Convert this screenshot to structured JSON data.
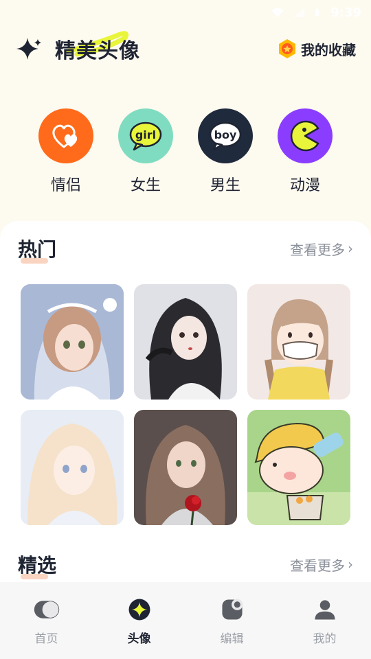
{
  "status_bar": {
    "time": "9:39"
  },
  "header": {
    "title": "精美头像",
    "favorites_label": "我的收藏"
  },
  "categories": [
    {
      "label": "情侣",
      "color": "#ff6b1a",
      "icon": "heart-icon"
    },
    {
      "label": "女生",
      "color": "#7fdcc0",
      "icon": "girl-bubble-icon",
      "badge": "girl"
    },
    {
      "label": "男生",
      "color": "#1f2a3c",
      "icon": "boy-bubble-icon",
      "badge": "boy"
    },
    {
      "label": "动漫",
      "color": "#8b3dff",
      "icon": "pacman-icon"
    }
  ],
  "hot": {
    "title": "热门",
    "more_label": "查看更多"
  },
  "featured": {
    "title": "精选",
    "more_label": "查看更多"
  },
  "tabs": [
    {
      "label": "首页",
      "icon": "home-toggle-icon",
      "active": false
    },
    {
      "label": "头像",
      "icon": "avatar-sparkle-icon",
      "active": true
    },
    {
      "label": "编辑",
      "icon": "edit-moon-icon",
      "active": false
    },
    {
      "label": "我的",
      "icon": "profile-icon",
      "active": false
    }
  ],
  "colors": {
    "background": "#fdfaf0",
    "accent_yellow": "#e8f53a",
    "text_primary": "#1f2433",
    "text_secondary": "#8a8f99"
  }
}
